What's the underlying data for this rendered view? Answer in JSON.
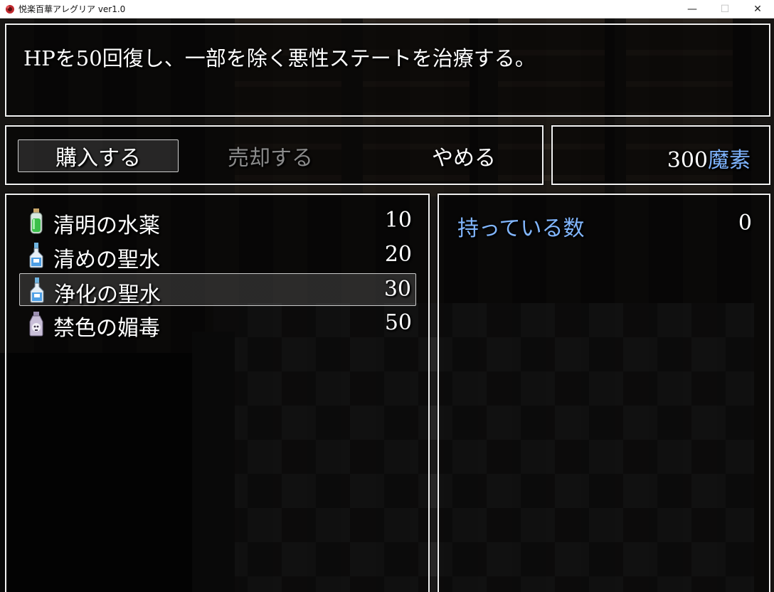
{
  "window": {
    "title": "悦楽百華アレグリア ver1.0",
    "icon": "app-flower-icon",
    "minimize_glyph": "—",
    "maximize_glyph": "☐",
    "close_glyph": "✕"
  },
  "help": {
    "text": "HPを50回復し、一部を除く悪性ステートを治療する。"
  },
  "commands": {
    "buy_label": "購入する",
    "sell_label": "売却する",
    "cancel_label": "やめる"
  },
  "gold": {
    "amount": "300",
    "unit": "魔素"
  },
  "items": [
    {
      "name": "清明の水薬",
      "price": "10",
      "icon": "green-potion-icon"
    },
    {
      "name": "清めの聖水",
      "price": "20",
      "icon": "blue-holy-water-icon"
    },
    {
      "name": "浄化の聖水",
      "price": "30",
      "icon": "blue-holy-water-icon"
    },
    {
      "name": "禁色の媚毒",
      "price": "50",
      "icon": "skull-poison-icon"
    }
  ],
  "selected_index": 2,
  "status": {
    "possession_label": "持っている数",
    "possession_value": "0"
  },
  "colors": {
    "system_blue": "#82b7ff",
    "disabled_gray": "#8a8a8a",
    "window_border": "#f2f2f2"
  }
}
